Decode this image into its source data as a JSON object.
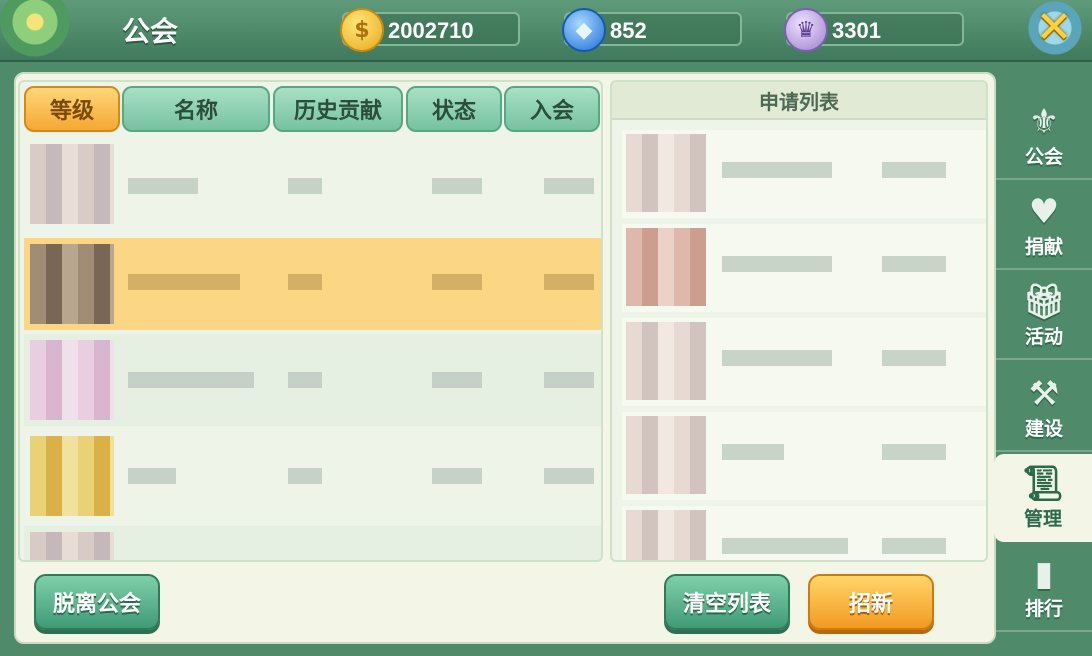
{
  "header": {
    "title": "公会",
    "resources": [
      {
        "icon": "gold-coin-icon",
        "value": "2002710"
      },
      {
        "icon": "blue-gem-icon",
        "value": "852"
      },
      {
        "icon": "crown-icon",
        "value": "3301"
      }
    ]
  },
  "member_list": {
    "headers": [
      "等级",
      "名称",
      "历史贡献",
      "状态",
      "入会"
    ],
    "selected_row": 1
  },
  "apply_list": {
    "title": "申请列表"
  },
  "buttons": {
    "leave": "脱离公会",
    "clear": "清空列表",
    "recruit": "招新"
  },
  "sidebar": {
    "items": [
      {
        "label": "公会",
        "icon": "guild-banner-icon"
      },
      {
        "label": "捐献",
        "icon": "heart-donate-icon"
      },
      {
        "label": "活动",
        "icon": "gift-icon"
      },
      {
        "label": "建设",
        "icon": "hammer-icon"
      },
      {
        "label": "管理",
        "icon": "scroll-icon",
        "active": true
      },
      {
        "label": "排行",
        "icon": "bar-chart-icon"
      }
    ]
  },
  "colors": {
    "accent_green": "#3f9a76",
    "accent_orange": "#f29a22",
    "selected_row": "#fbd785"
  }
}
